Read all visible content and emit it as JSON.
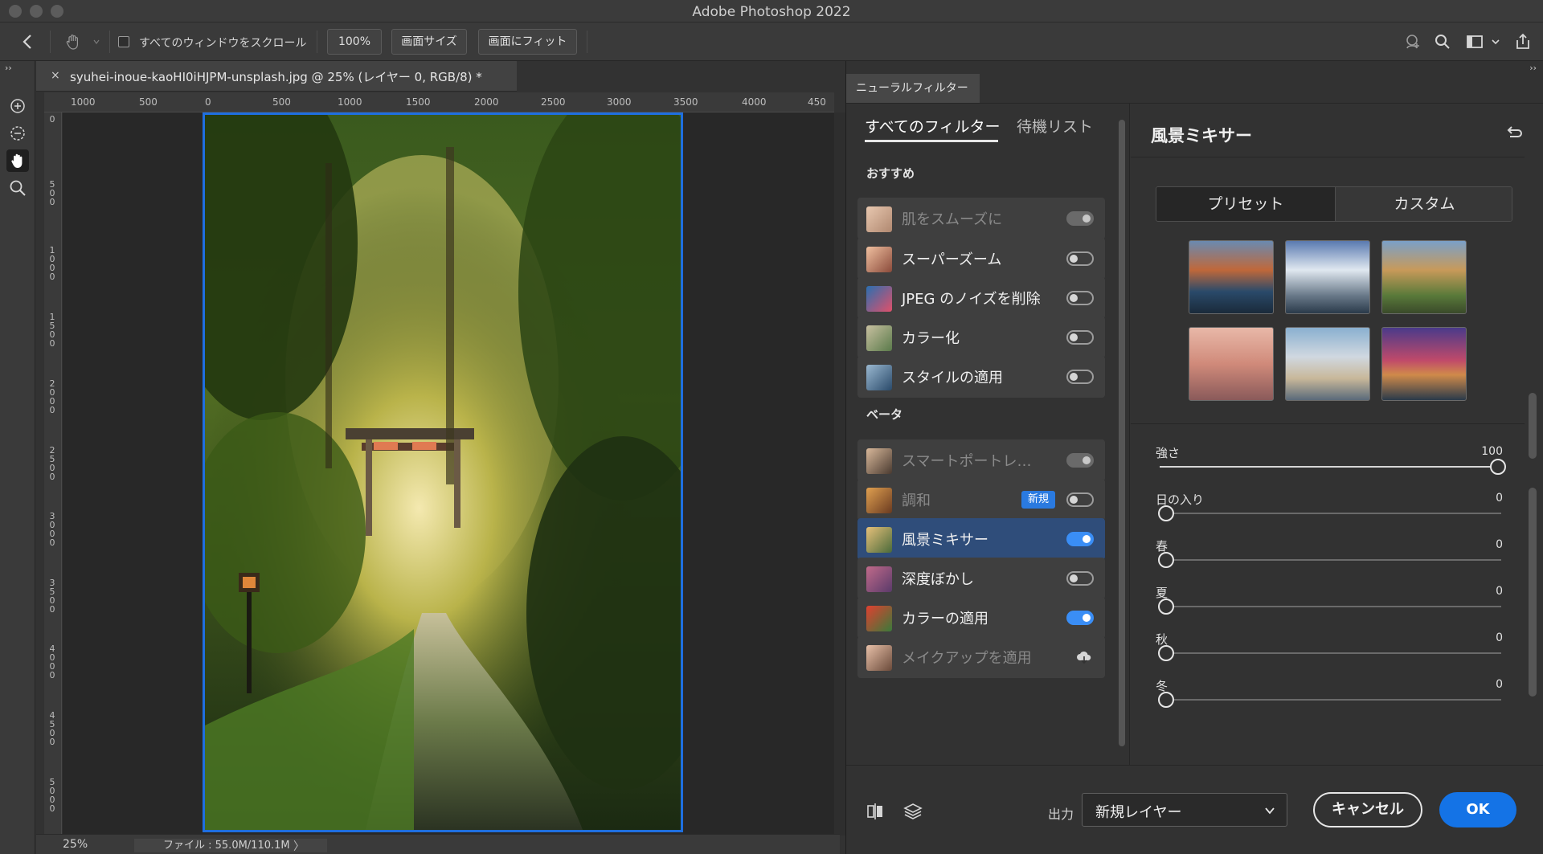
{
  "window": {
    "title": "Adobe Photoshop 2022"
  },
  "options_bar": {
    "scroll_all_label": "すべてのウィンドウをスクロール",
    "scroll_all_checked": false,
    "zoom_100_label": "100%",
    "fill_screen_label": "画面サイズ",
    "fit_screen_label": "画面にフィット"
  },
  "document": {
    "tab_title": "syuhei-inoue-kaoHI0iHJPM-unsplash.jpg @ 25% (レイヤー 0, RGB/8) *",
    "close_glyph": "×",
    "ruler_top": [
      "1000",
      "500",
      "0",
      "500",
      "1000",
      "1500",
      "2000",
      "2500",
      "3000",
      "3500",
      "4000",
      "450"
    ],
    "ruler_left": [
      "0",
      "500",
      "1000",
      "1500",
      "2000",
      "2500",
      "3000",
      "3500",
      "4000",
      "4500",
      "5000"
    ]
  },
  "status_bar": {
    "zoom": "25%",
    "file_info": "ファイル : 55.0M/110.1M",
    "arrow": "〉"
  },
  "neural_panel": {
    "tab_label": "ニューラルフィルター",
    "tabs": [
      "すべてのフィルター",
      "待機リスト"
    ],
    "sections": [
      {
        "label": "おすすめ",
        "items": [
          {
            "label": "肌をスムーズに",
            "toggle": "dim",
            "disabled": true
          },
          {
            "label": "スーパーズーム",
            "toggle": "off",
            "disabled": false
          },
          {
            "label": "JPEG のノイズを削除",
            "toggle": "off",
            "disabled": false
          },
          {
            "label": "カラー化",
            "toggle": "off",
            "disabled": false
          },
          {
            "label": "スタイルの適用",
            "toggle": "off",
            "disabled": false
          }
        ]
      },
      {
        "label": "ベータ",
        "items": [
          {
            "label": "スマートポートレ…",
            "toggle": "dim",
            "disabled": true
          },
          {
            "label": "調和",
            "toggle": "off",
            "disabled": true,
            "badge": "新規"
          },
          {
            "label": "風景ミキサー",
            "toggle": "on",
            "disabled": false,
            "selected": true
          },
          {
            "label": "深度ぼかし",
            "toggle": "off",
            "disabled": false
          },
          {
            "label": "カラーの適用",
            "toggle": "on",
            "disabled": false
          },
          {
            "label": "メイクアップを適用",
            "toggle": "cloud",
            "disabled": true
          }
        ]
      }
    ],
    "settings": {
      "title": "風景ミキサー",
      "segments": [
        "プリセット",
        "カスタム"
      ],
      "sliders": [
        {
          "label": "強さ",
          "value": "100",
          "fraction": 1.0
        },
        {
          "label": "日の入り",
          "value": "0",
          "fraction": 0.0
        },
        {
          "label": "春",
          "value": "0",
          "fraction": 0.0
        },
        {
          "label": "夏",
          "value": "0",
          "fraction": 0.0
        },
        {
          "label": "秋",
          "value": "0",
          "fraction": 0.0
        },
        {
          "label": "冬",
          "value": "0",
          "fraction": 0.0
        }
      ]
    },
    "footer": {
      "output_label": "出力",
      "output_value": "新規レイヤー",
      "cancel_label": "キャンセル",
      "ok_label": "OK"
    }
  },
  "colors": {
    "accent": "#1473e6",
    "selection": "#2f4d7a",
    "canvas_border": "#1f6fe0"
  }
}
